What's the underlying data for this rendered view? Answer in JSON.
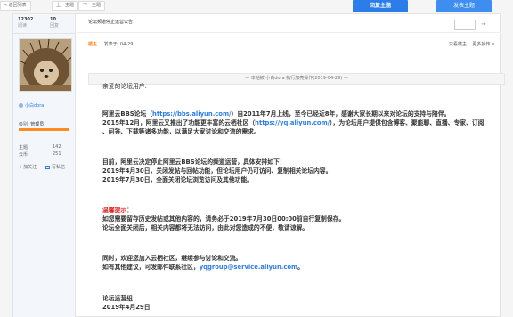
{
  "toolbar": {
    "back_label": "« 返回列表",
    "prev_label": "上一主题",
    "next_label": "下一主题",
    "reply_label": "回复主题",
    "post_label": "发表主题"
  },
  "stats": {
    "views": "12302",
    "views_label": "阅读",
    "replies": "10",
    "replies_label": "回复"
  },
  "author": {
    "name": "小白dora",
    "rank_label": "级别:",
    "rank": "管理员",
    "level_progress_pct": 100,
    "topics_label": "主题",
    "topics": "142",
    "coins_label": "云币",
    "coins": "251",
    "follow_label": "加关注",
    "message_label": "写私信"
  },
  "thread": {
    "title": "论坛频道停止运营公告",
    "op_badge": "楼主",
    "posted_at": "发表于: 04-29",
    "view_only_label": "只看楼主",
    "more_label": "更多操作",
    "edit_note": "— 本帖被 小白dora 执行加亮操作(2019-04-29) —"
  },
  "content": {
    "greeting": "亲爱的论坛用户:",
    "p1_line1_a": "阿里云BBS论坛（",
    "p1_line1_link": "https://bbs.aliyun.com/",
    "p1_line1_b": "）自2011年7月上线，至今已经近8年，感谢大家长期以来对论坛的支持与陪伴。",
    "p1_line2_a": "2015年12月，阿里云又推出了功能更丰富的云栖社区（",
    "p1_line2_link": "https://yq.aliyun.com/",
    "p1_line2_b": "），为论坛用户提供包含博客、聚能聊、直播、专家、订阅",
    "p1_line3": "、问答、下载等诸多功能，以满足大家讨论和交流的需求。",
    "p2_line1": "目前，阿里云决定停止阿里云BBS论坛的频道运营，具体安排如下：",
    "p2_line2": "2019年4月30日，关闭发帖与回帖功能，但论坛用户仍可访问、复制相关论坛内容。",
    "p2_line3": "2019年7月30日，全面关闭论坛浏览访问及其他功能。",
    "warm_tip": "温馨提示：",
    "tip_line1": "如您需要留存历史发帖或其他内容的，请务必于2019年7月30日00:00前自行复制保存。",
    "tip_line2": "论坛全面关闭后，相关内容都将无法访问，由此对您造成的不便，敬请谅解。",
    "p4_line1": "同时，欢迎您加入云栖社区，继续参与讨论和交流。",
    "p4_line2_a": "如有其他建议，可发邮件联系社区，",
    "p4_line2_link": "yqgroup@service.aliyun.com",
    "p4_line2_b": "。",
    "sign_team": "论坛运营组",
    "sign_date": "2019年4月29日"
  }
}
